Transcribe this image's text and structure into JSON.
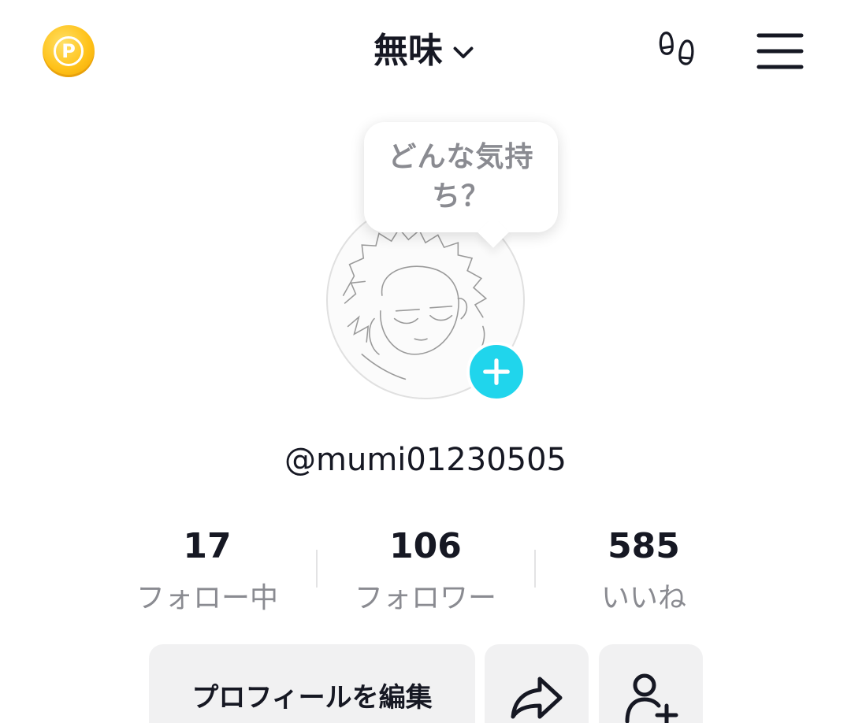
{
  "header": {
    "title": "無味",
    "coin_letter": "P",
    "coin_icon": "coin-p-icon",
    "title_chevron_icon": "chevron-down-icon",
    "footprint_icon": "footprints-icon",
    "menu_icon": "hamburger-menu-icon"
  },
  "avatar": {
    "mood_prompt": "どんな気持ち？",
    "add_icon": "plus-icon"
  },
  "profile": {
    "username": "@mumi01230505"
  },
  "stats": [
    {
      "value": "17",
      "label": "フォロー中"
    },
    {
      "value": "106",
      "label": "フォロワー"
    },
    {
      "value": "585",
      "label": "いいね"
    }
  ],
  "actions": {
    "edit_profile_label": "プロフィールを編集",
    "share_icon": "share-arrow-icon",
    "add_friend_icon": "add-user-icon"
  },
  "colors": {
    "accent_cyan": "#20d5ec",
    "coin_gold": "#ffc21a",
    "text_primary": "#161823",
    "text_secondary": "#8a8b91",
    "button_bg": "#f1f1f2"
  }
}
